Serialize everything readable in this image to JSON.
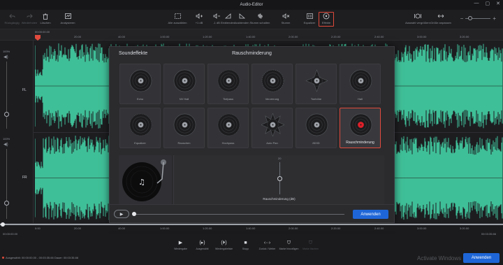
{
  "window": {
    "title": "Audio-Editor",
    "minimize": "—",
    "maximize": "▢",
    "close": "✕"
  },
  "toolbar": {
    "undo": "Rückgängig",
    "redo": "Wiederholen",
    "delete": "Löschen",
    "analyze": "Analysieren",
    "select_all": "Alle auswählen",
    "vol_up": "+1 dB",
    "vol_down": "-1 dB",
    "fade_in": "Einblenden",
    "fade_out": "Ausblenden",
    "noise_fill": "Stumm schalten",
    "silence": "Stumm",
    "equalizer": "Equalizer",
    "effects": "Effekte",
    "zoom_sel": "Auswahl vergrößern",
    "zoom_fit": "Größe anpassen",
    "zoom_minus": "−",
    "zoom_plus": "+"
  },
  "ruler": {
    "current_time": "00:00:00.00",
    "ticks": [
      "20.00",
      "40.00",
      "1:00.00",
      "1:20.00",
      "1:40.00",
      "2:00.00",
      "2:20.00",
      "2:40.00",
      "3:00.00",
      "3:20.00"
    ]
  },
  "tracks": {
    "db_top": "100%",
    "db_mid": "100%",
    "fl_label": "FL",
    "fr_label": "FR"
  },
  "dialog": {
    "title_left": "Soundeffekte",
    "title_center": "Rauschminderung",
    "effects": [
      {
        "label": "Echo"
      },
      {
        "label": "NV Hall"
      },
      {
        "label": "Tiefpass"
      },
      {
        "label": "Verzerrung"
      },
      {
        "label": "Tonhöhe"
      },
      {
        "label": "Hall"
      },
      {
        "label": "Equalizer"
      },
      {
        "label": "Rauschen"
      },
      {
        "label": "Hochpass"
      },
      {
        "label": "Auto Pan"
      },
      {
        "label": "8D3D"
      },
      {
        "label": "Rauschminderung"
      }
    ],
    "selected_effect": "Rauschminderung",
    "slider_value_label": "20",
    "slider_caption": "Rauschminderung (dB)",
    "apply": "Anwenden"
  },
  "bottom_ruler": {
    "ticks": [
      "0:00",
      "20.00",
      "40.00",
      "1:00.00",
      "1:20.00",
      "1:40.00",
      "2:00.00",
      "2:20.00",
      "2:40.00",
      "3:00.00",
      "3:20.00"
    ],
    "time_left": "00:00:00.00",
    "time_right": "00:03:35.66"
  },
  "transport": {
    "play": "Wiedergabe",
    "play_sel": "Ausgewählt",
    "loop": "Wiedergabeliste",
    "stop": "Stopp",
    "back_forward": "Zurück / Weiter",
    "marker_add": "Marke hinzufügen",
    "marker_list": "Marke löschen"
  },
  "status": "Ausgewählt: 00:00:00.00 - 00:03:35.66 Dauer: 00:03:35.66",
  "apply_main": "Anwenden",
  "watermark": "Activate Windows",
  "colors": {
    "accent_red": "#e04a3c",
    "wave": "#3fbf97",
    "button_blue": "#1e66d8"
  },
  "icons": {
    "effects": "vinyl-icon",
    "play": "play-icon",
    "stop": "stop-icon"
  }
}
